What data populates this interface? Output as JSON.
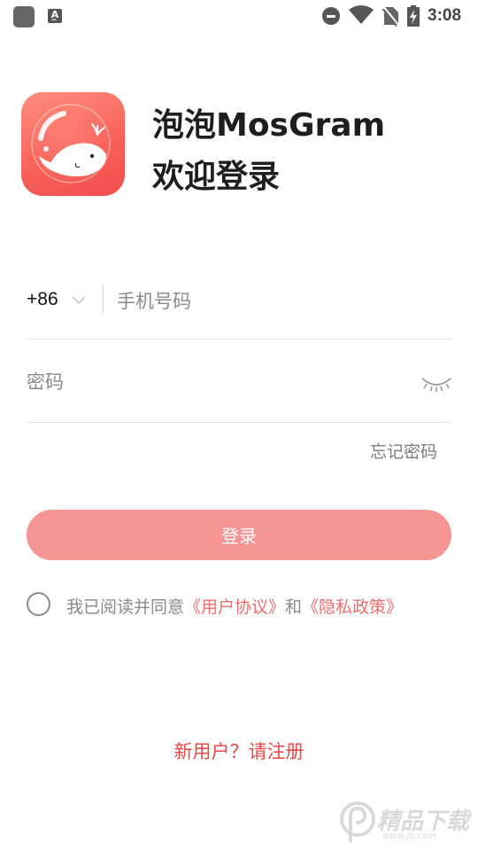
{
  "status_bar": {
    "time": "3:08",
    "icons": [
      "app-icon",
      "a-notification-icon",
      "do-not-disturb-icon",
      "wifi-icon",
      "no-sim-icon",
      "battery-charging-icon"
    ]
  },
  "header": {
    "app_name": "泡泡MosGram",
    "welcome": "欢迎登录",
    "logo_icon": "whale-bubble-logo"
  },
  "form": {
    "country_code": "+86",
    "phone_placeholder": "手机号码",
    "password_placeholder": "密码",
    "password_toggle_icon": "eye-closed-icon",
    "forgot_password": "忘记密码",
    "login_button": "登录"
  },
  "agreement": {
    "prefix": "我已阅读并同意",
    "user_agreement": "《用户协议》",
    "and": "和",
    "privacy_policy": "《隐私政策》",
    "checked": false
  },
  "register": {
    "label": "新用户？请注册"
  },
  "watermark": {
    "text": "精品下载",
    "url": "www.jb.com"
  },
  "colors": {
    "accent": "#e04a4a",
    "button": "#f59594",
    "link": "#e8706e",
    "logo_gradient_start": "#ff8f7e",
    "logo_gradient_end": "#f24d4d"
  }
}
